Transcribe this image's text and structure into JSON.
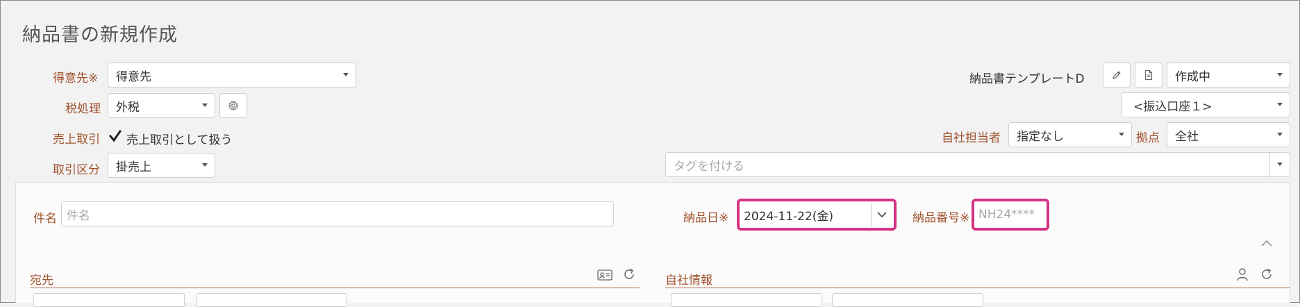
{
  "page": {
    "title": "納品書の新規作成"
  },
  "form": {
    "customer": {
      "label": "得意先※",
      "value": "得意先"
    },
    "tax": {
      "label": "税処理",
      "value": "外税"
    },
    "sales": {
      "label": "売上取引",
      "checkbox_label": "売上取引として扱う",
      "checked": true
    },
    "transaction_type": {
      "label": "取引区分",
      "value": "掛売上"
    },
    "template": {
      "label": "納品書テンプレートD"
    },
    "status": {
      "value": "作成中"
    },
    "bank_account": {
      "value": "<振込口座１>"
    },
    "staff": {
      "label": "自社担当者",
      "value": "指定なし"
    },
    "base": {
      "label": "拠点",
      "value": "全社"
    },
    "tags": {
      "placeholder": "タグを付ける"
    }
  },
  "detail": {
    "subject": {
      "label": "件名",
      "placeholder": "件名"
    },
    "delivery_date": {
      "label": "納品日※",
      "value": "2024-11-22(金)"
    },
    "delivery_number": {
      "label": "納品番号※",
      "placeholder": "NH24****"
    },
    "recipient_section": {
      "title": "宛先"
    },
    "company_section": {
      "title": "自社情報"
    }
  },
  "colors": {
    "accent_label": "#a0522d",
    "highlight": "#d63384"
  }
}
